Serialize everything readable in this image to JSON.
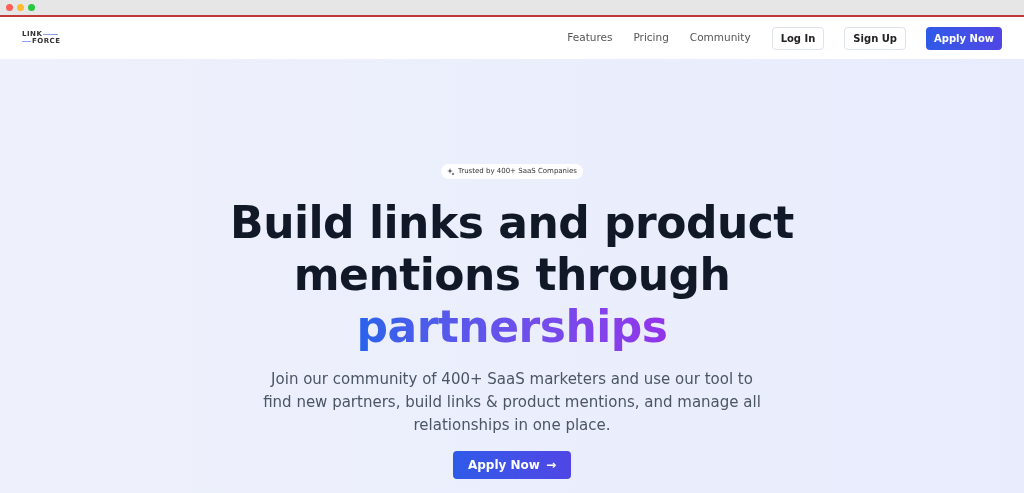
{
  "logo": {
    "top": "LINK",
    "bottom": "FORCE"
  },
  "nav": {
    "links": [
      "Features",
      "Pricing",
      "Community"
    ],
    "login": "Log In",
    "signup": "Sign Up",
    "apply": "Apply Now"
  },
  "hero": {
    "badge": "Trusted by 400+ SaaS Companies",
    "heading": "Build links and product mentions through",
    "highlight": "partnerships",
    "text": "Join our community of 400+ SaaS marketers and use our tool to find new partners, build links & product mentions, and manage all relationships in one place.",
    "cta": "Apply Now",
    "cta_arrow": "→"
  }
}
